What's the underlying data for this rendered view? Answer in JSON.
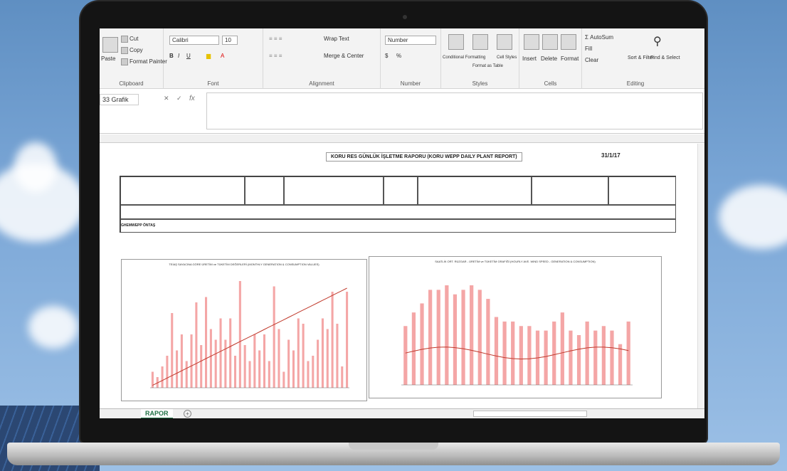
{
  "ribbon": {
    "clipboard": {
      "paste": "Paste",
      "cut": "Cut",
      "copy": "Copy",
      "format_painter": "Format Painter",
      "label": "Clipboard"
    },
    "font": {
      "name": "Calibri",
      "size": "10",
      "label": "Font"
    },
    "alignment": {
      "wrap_text": "Wrap Text",
      "merge_center": "Merge & Center",
      "label": "Alignment"
    },
    "number": {
      "format": "Number",
      "currency": "$",
      "percent": "%",
      "label": "Number"
    },
    "styles": {
      "conditional": "Conditional Formatting",
      "format_table": "Format as Table",
      "cell_styles": "Cell Styles",
      "label": "Styles"
    },
    "cells": {
      "insert": "Insert",
      "delete": "Delete",
      "format": "Format",
      "label": "Cells"
    },
    "editing": {
      "autosum": "AutoSum",
      "fill": "Fill",
      "clear": "Clear",
      "sort_filter": "Sort & Filter",
      "find_select": "Find & Select",
      "label": "Editing"
    }
  },
  "formula_bar": {
    "name_box": "33 Grafik",
    "fx": "fx",
    "cancel": "✕",
    "confirm": "✓"
  },
  "report": {
    "title": "KORU RES GÜNLÜK İŞLETME RAPORU (KORU WEPP DAILY PLANT REPORT)",
    "date": "31/1/17",
    "row_label": "GHEMWEPP ÖNTAŞ"
  },
  "charts": {
    "left_title": "TEİAŞ SAYACINA GÖRE ÜRETİM ve TÜKETİM DEĞERLERİ (MONTHLY GENERATION & CONSUMPTION VALUES)",
    "right_title": "SAATLİK ORT. RÜZGAR - ÜRETİM ve TÜKETİM GRAFİĞİ (HOURLY AVE. WIND SPEED - GENERATION & CONSUMPTION)",
    "bar_color": "#f4a6a6",
    "line_color": "#c0392b",
    "blue_line": "#1f5bb5"
  },
  "chart_data": [
    {
      "type": "bar",
      "values": [
        3,
        2,
        4,
        6,
        14,
        7,
        10,
        5,
        10,
        16,
        8,
        17,
        11,
        9,
        13,
        9,
        13,
        6,
        20,
        8,
        5,
        10,
        7,
        10,
        5,
        19,
        11,
        3,
        9,
        7,
        13,
        12,
        5,
        6,
        9,
        13,
        11,
        18,
        12,
        4,
        18
      ]
    },
    {
      "type": "bar",
      "values": [
        13,
        16,
        18,
        21,
        21,
        22,
        20,
        21,
        22,
        21,
        19,
        15,
        14,
        14,
        13,
        13,
        12,
        12,
        14,
        16,
        12,
        11,
        14,
        12,
        13,
        12,
        9,
        14
      ]
    }
  ],
  "sheet_tabs": {
    "active": "RAPOR",
    "add": "+"
  }
}
